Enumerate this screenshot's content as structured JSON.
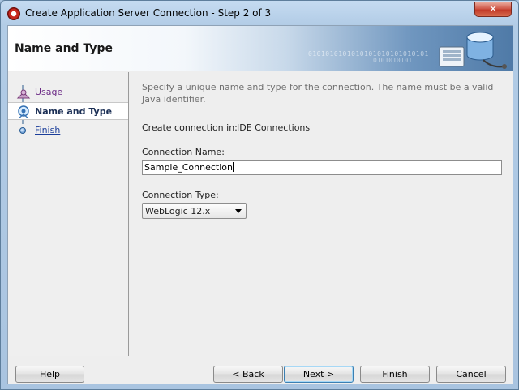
{
  "window": {
    "title": "Create Application Server Connection - Step 2 of 3",
    "close_glyph": "✕"
  },
  "header": {
    "title": "Name and Type",
    "binary_line1": "0101010101010101010101010101",
    "binary_line2": "0101010101"
  },
  "nav": {
    "items": [
      {
        "label": "Usage",
        "state": "visited"
      },
      {
        "label": "Name and Type",
        "state": "current"
      },
      {
        "label": "Finish",
        "state": "link"
      }
    ]
  },
  "main": {
    "intro": "Specify a unique name and type for the connection. The name must be a valid Java identifier.",
    "create_in_label": "Create connection in:",
    "create_in_value": "IDE Connections",
    "name_label": "Connection Name:",
    "name_value": "Sample_Connection",
    "type_label": "Connection Type:",
    "type_value": "WebLogic 12.x"
  },
  "buttons": {
    "help": "Help",
    "back": "< Back",
    "next": "Next >",
    "finish": "Finish",
    "cancel": "Cancel"
  }
}
